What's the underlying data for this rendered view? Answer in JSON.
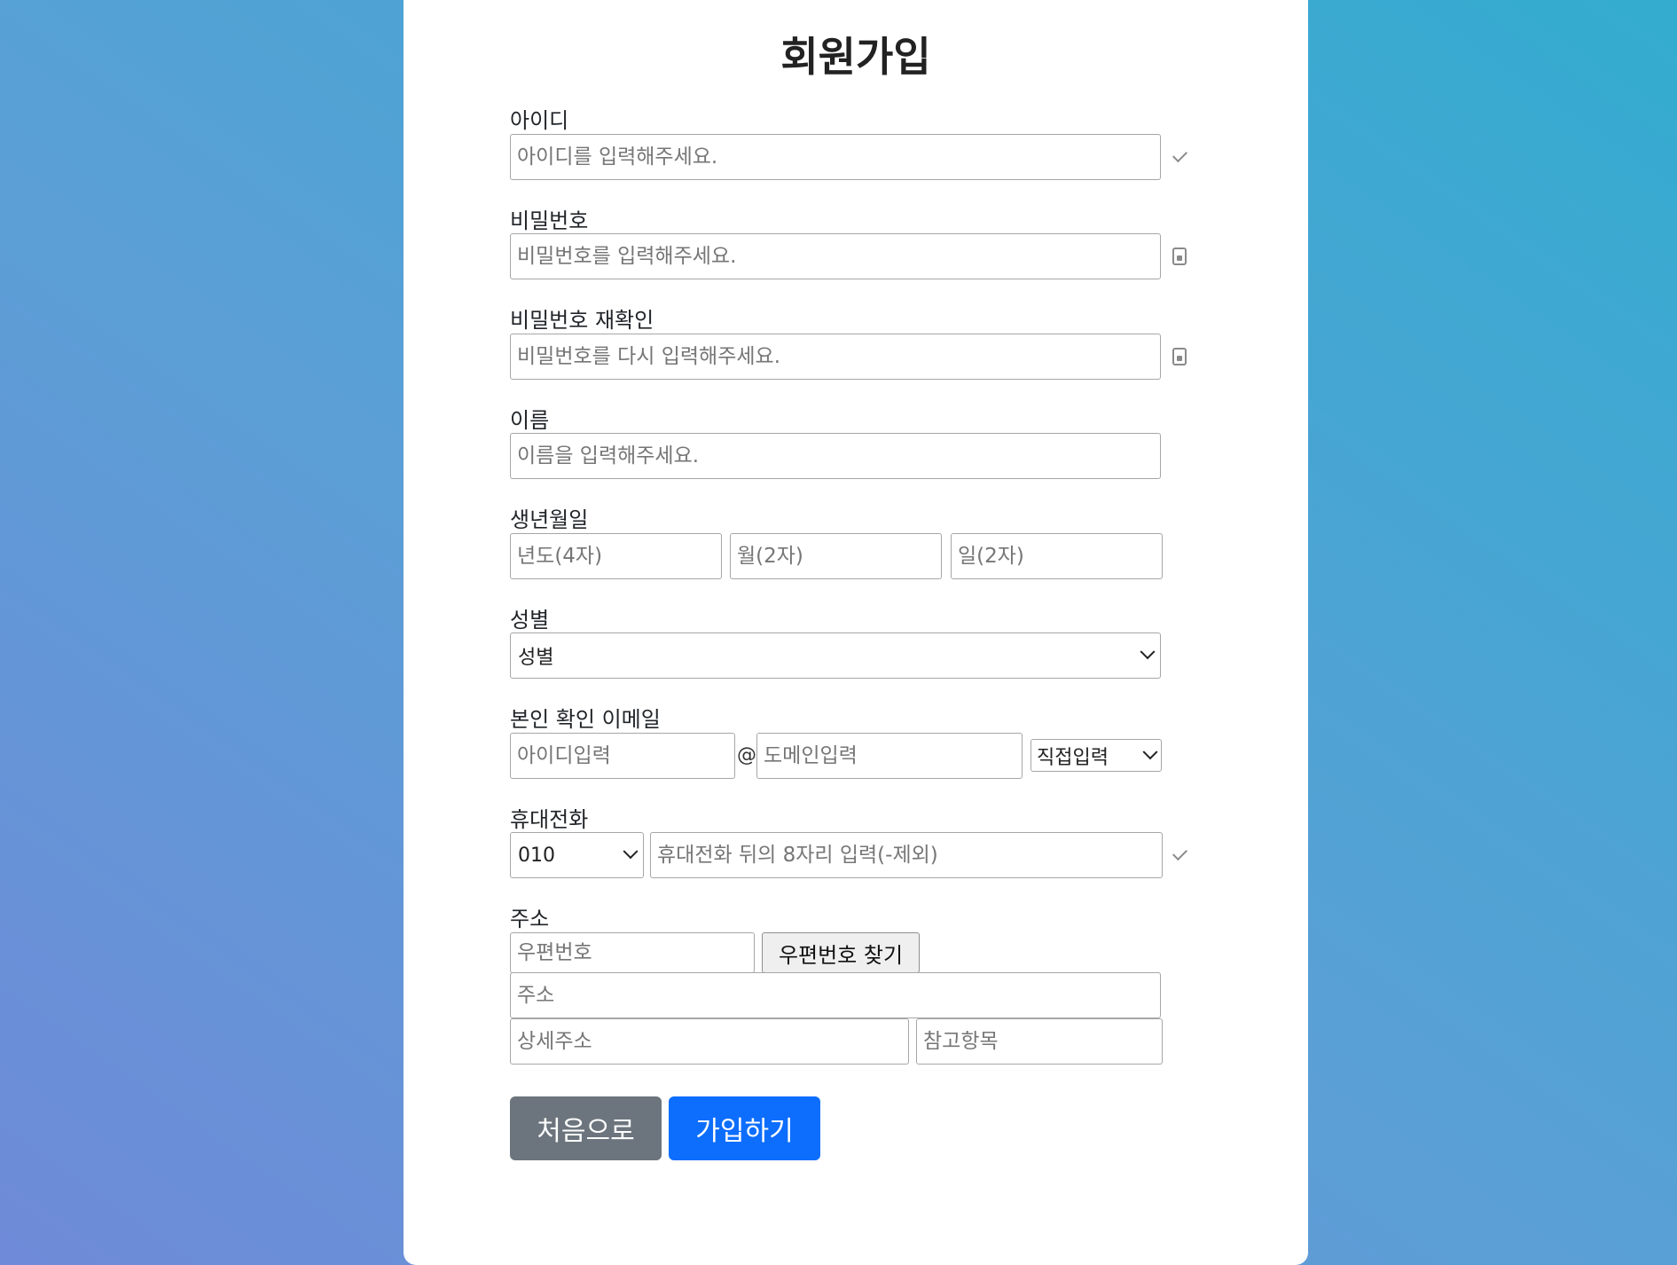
{
  "page_title": "회원가입",
  "colors": {
    "primary": "#0d6efd",
    "secondary": "#6c757d",
    "background_start": "#6f8ad8",
    "background_end": "#33acd0"
  },
  "fields": {
    "userid": {
      "label": "아이디",
      "placeholder": "아이디를 입력해주세요.",
      "icon": "check-icon"
    },
    "password": {
      "label": "비밀번호",
      "placeholder": "비밀번호를 입력해주세요.",
      "icon": "lock-icon"
    },
    "password_confirm": {
      "label": "비밀번호 재확인",
      "placeholder": "비밀번호를 다시 입력해주세요.",
      "icon": "lock-icon"
    },
    "name": {
      "label": "이름",
      "placeholder": "이름을 입력해주세요."
    },
    "birth": {
      "label": "생년월일",
      "year_placeholder": "년도(4자)",
      "month_placeholder": "월(2자)",
      "day_placeholder": "일(2자)"
    },
    "gender": {
      "label": "성별",
      "selected": "성별"
    },
    "email": {
      "label": "본인 확인 이메일",
      "id_placeholder": "아이디입력",
      "at": "@",
      "domain_placeholder": "도메인입력",
      "domain_select": "직접입력"
    },
    "phone": {
      "label": "휴대전화",
      "prefix_selected": "010",
      "placeholder": "휴대전화 뒤의 8자리 입력(-제외)",
      "icon": "check-icon"
    },
    "address": {
      "label": "주소",
      "zipcode_placeholder": "우편번호",
      "find_zip_button": "우편번호 찾기",
      "address_placeholder": "주소",
      "detail_placeholder": "상세주소",
      "extra_placeholder": "참고항목"
    }
  },
  "buttons": {
    "back": "처음으로",
    "submit": "가입하기"
  }
}
